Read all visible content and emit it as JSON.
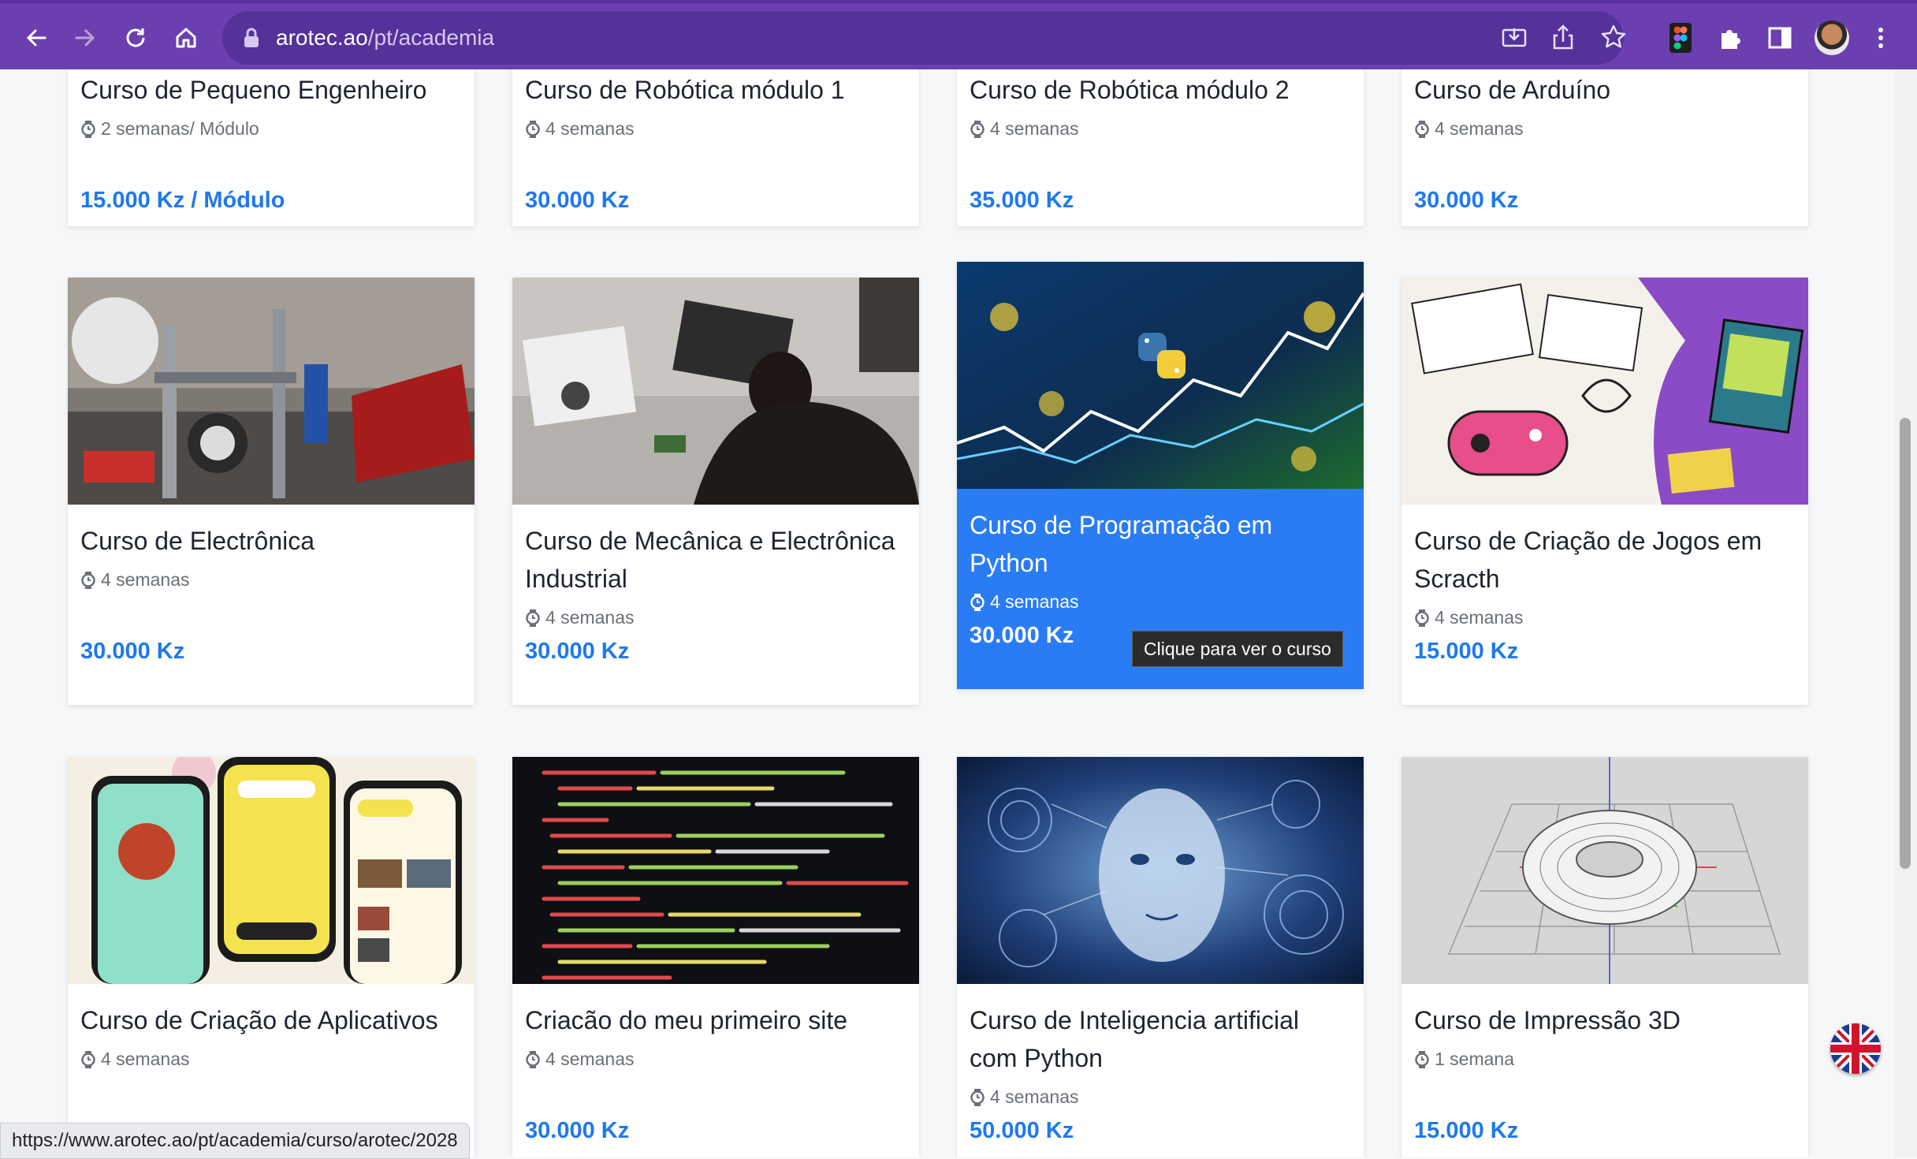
{
  "browser": {
    "url_host": "arotec.ao",
    "url_path": "/pt/academia",
    "icons": [
      "back-arrow-icon",
      "forward-arrow-icon",
      "reload-icon",
      "home-icon",
      "lock-icon",
      "install-icon",
      "share-icon",
      "bookmark-star-icon",
      "figma-icon",
      "extensions-puzzle-icon",
      "side-panel-icon",
      "profile-avatar",
      "menu-kebab-icon"
    ]
  },
  "courses": [
    {
      "title": "Curso de Pequeno Engenheiro",
      "duration": "2 semanas/ Módulo",
      "price": "15.000 Kz / Módulo"
    },
    {
      "title": "Curso de Robótica módulo 1",
      "duration": "4 semanas",
      "price": "30.000 Kz"
    },
    {
      "title": "Curso de Robótica módulo 2",
      "duration": "4 semanas",
      "price": "35.000 Kz"
    },
    {
      "title": "Curso de Arduíno",
      "duration": "4 semanas",
      "price": "30.000 Kz"
    },
    {
      "title": "Curso de Electrônica",
      "duration": "4 semanas",
      "price": "30.000 Kz",
      "image": "robot-build-photo"
    },
    {
      "title": "Curso de Mecânica e Electrônica Industrial",
      "duration": "4 semanas",
      "price": "30.000 Kz",
      "image": "students-laptop-photo"
    },
    {
      "title": "Curso de Programação em Python",
      "duration": "4 semanas",
      "price": "30.000 Kz",
      "image": "python-chart-image",
      "hovered": true
    },
    {
      "title": "Curso de Criação de Jogos em Scracth",
      "duration": "4 semanas",
      "price": "15.000 Kz",
      "image": "game-illustration"
    },
    {
      "title": "Curso de Criação de Aplicativos",
      "duration": "4 semanas",
      "price": "",
      "image": "phone-app-mockups"
    },
    {
      "title": "Criacão do meu primeiro site",
      "duration": "4 semanas",
      "price": "30.000 Kz",
      "image": "code-editor-photo"
    },
    {
      "title": "Curso de Inteligencia artificial com Python",
      "duration": "4 semanas",
      "price": "50.000 Kz",
      "image": "ai-face-image"
    },
    {
      "title": "Curso de Impressão 3D",
      "duration": "1 semana",
      "price": "15.000 Kz",
      "image": "3d-torus-render"
    }
  ],
  "tooltip": "Clique para ver o curso",
  "status_url": "https://www.arotec.ao/pt/academia/curso/arotec/2028",
  "language_flag": "uk-flag-icon",
  "colors": {
    "browser_bar": "#6b3fb0",
    "accent": "#1e78f0",
    "active_card": "#2a7cf5"
  }
}
